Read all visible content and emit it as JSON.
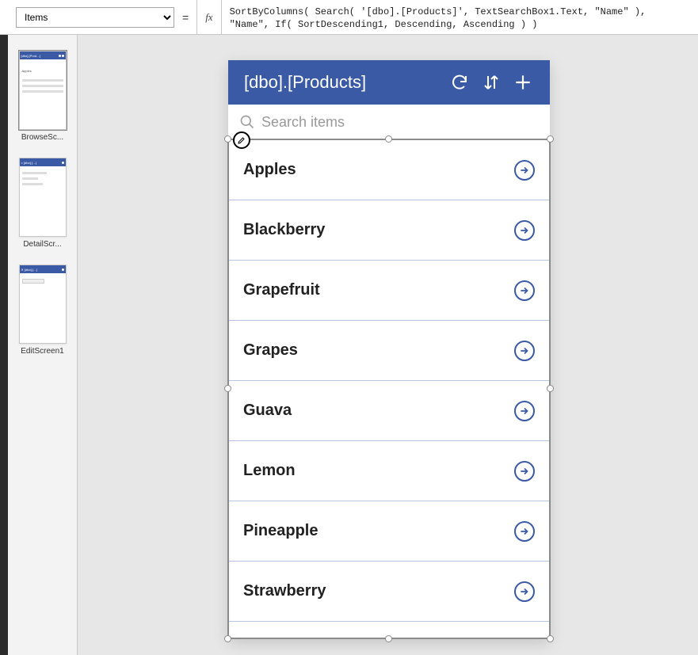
{
  "formula_bar": {
    "property": "Items",
    "equals": "=",
    "fx": "fx",
    "formula": "SortByColumns( Search( '[dbo].[Products]', TextSearchBox1.Text, \"Name\" ),\n\"Name\", If( SortDescending1, Descending, Ascending ) )"
  },
  "screens": [
    {
      "label": "BrowseSc..."
    },
    {
      "label": "DetailScr..."
    },
    {
      "label": "EditScreen1"
    }
  ],
  "app": {
    "title": "[dbo].[Products]",
    "search_placeholder": "Search items",
    "items": [
      {
        "name": "Apples"
      },
      {
        "name": "Blackberry"
      },
      {
        "name": "Grapefruit"
      },
      {
        "name": "Grapes"
      },
      {
        "name": "Guava"
      },
      {
        "name": "Lemon"
      },
      {
        "name": "Pineapple"
      },
      {
        "name": "Strawberry"
      }
    ]
  }
}
